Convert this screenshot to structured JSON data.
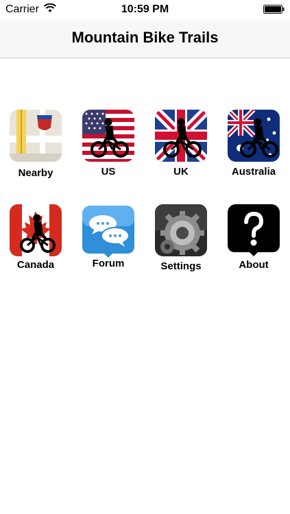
{
  "status_bar": {
    "carrier": "Carrier",
    "time": "10:59 PM"
  },
  "nav": {
    "title": "Mountain Bike Trails"
  },
  "grid": {
    "items": [
      {
        "label": "Nearby",
        "icon": "map-icon"
      },
      {
        "label": "US",
        "icon": "us-flag-rider-icon"
      },
      {
        "label": "UK",
        "icon": "uk-flag-rider-icon"
      },
      {
        "label": "Australia",
        "icon": "australia-flag-rider-icon"
      },
      {
        "label": "Canada",
        "icon": "canada-flag-rider-icon"
      },
      {
        "label": "Forum",
        "icon": "chat-bubbles-icon"
      },
      {
        "label": "Settings",
        "icon": "gear-icon"
      },
      {
        "label": "About",
        "icon": "question-mark-icon"
      }
    ]
  },
  "colors": {
    "us_red": "#c8102e",
    "us_blue": "#3c3b6e",
    "uk_blue": "#1f3f8f",
    "uk_red": "#d21034",
    "au_blue": "#0f2d7a",
    "ca_red": "#d52b1e",
    "forum_blue": "#2f8fd8"
  }
}
